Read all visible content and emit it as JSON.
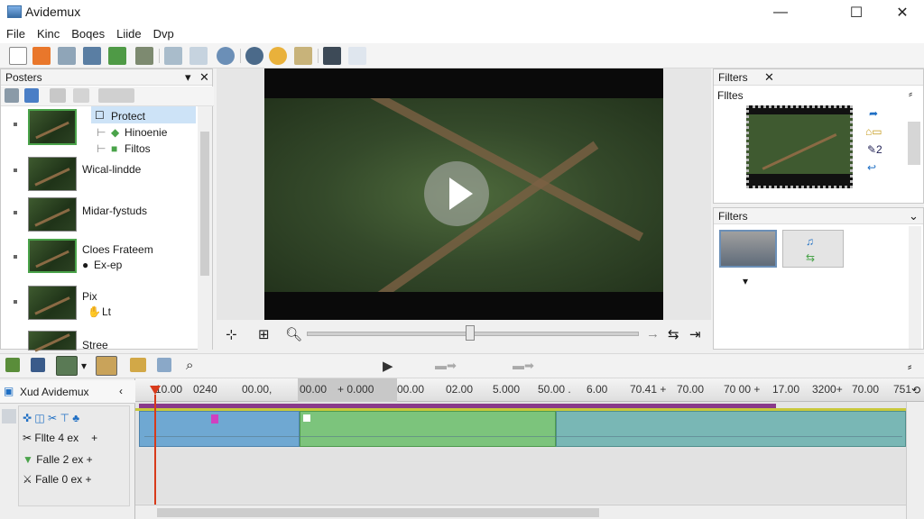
{
  "window": {
    "title": "Avidemux",
    "minimize": "—",
    "maximize": "☐",
    "close": "✕"
  },
  "menu": [
    "File",
    "Kinc",
    "Boqes",
    "Liide",
    "Dvp"
  ],
  "toolbar_icons": [
    "new-icon",
    "open-icon",
    "save-icon",
    "encode-icon",
    "export-icon",
    "settings-icon",
    "cursor-icon",
    "zoom-icon",
    "search-icon",
    "find-icon",
    "color-icon",
    "shuffle-icon",
    "filter-icon",
    "text-icon"
  ],
  "posters_panel": {
    "title": "Posters",
    "items": [
      {
        "label": "Protect",
        "sub1": "Hinoenie",
        "sub2": "Filtos"
      },
      {
        "label": "Wical-lindde"
      },
      {
        "label": "Midar-fystuds"
      },
      {
        "label": "Cloes Frateem",
        "sub1": "Ex-ep"
      },
      {
        "label": "Pix",
        "sub1": "Lt"
      },
      {
        "label": "Stree"
      }
    ]
  },
  "filters_panel_top": {
    "title": "Filters",
    "subtitle": "Flltes"
  },
  "filters_panel_bottom": {
    "title": "Filters"
  },
  "timeline": {
    "track_header": "Xud Avidemux",
    "ruler": [
      "10.00",
      "0240",
      "00.00,",
      "00.00",
      "+ 0.000",
      "00.00",
      "02.00",
      "5.000",
      "50.00 .",
      "6.00",
      "70.41 +",
      "70.00",
      "70 00 +",
      "17.00",
      "3200+",
      "70.00",
      "751"
    ],
    "rows": [
      {
        "label": ""
      },
      {
        "label": "Fllte 4 ex"
      },
      {
        "label": "Falle 2 ex",
        "suffix": "+"
      },
      {
        "label": "Falle 0 ex",
        "suffix": "+"
      }
    ]
  },
  "colors": {
    "blue_clip": "#6fa8d2",
    "green_clip": "#7cc47c",
    "teal_clip": "#79b7b5",
    "playhead": "#d83a1a",
    "accent": "#0078d7"
  }
}
